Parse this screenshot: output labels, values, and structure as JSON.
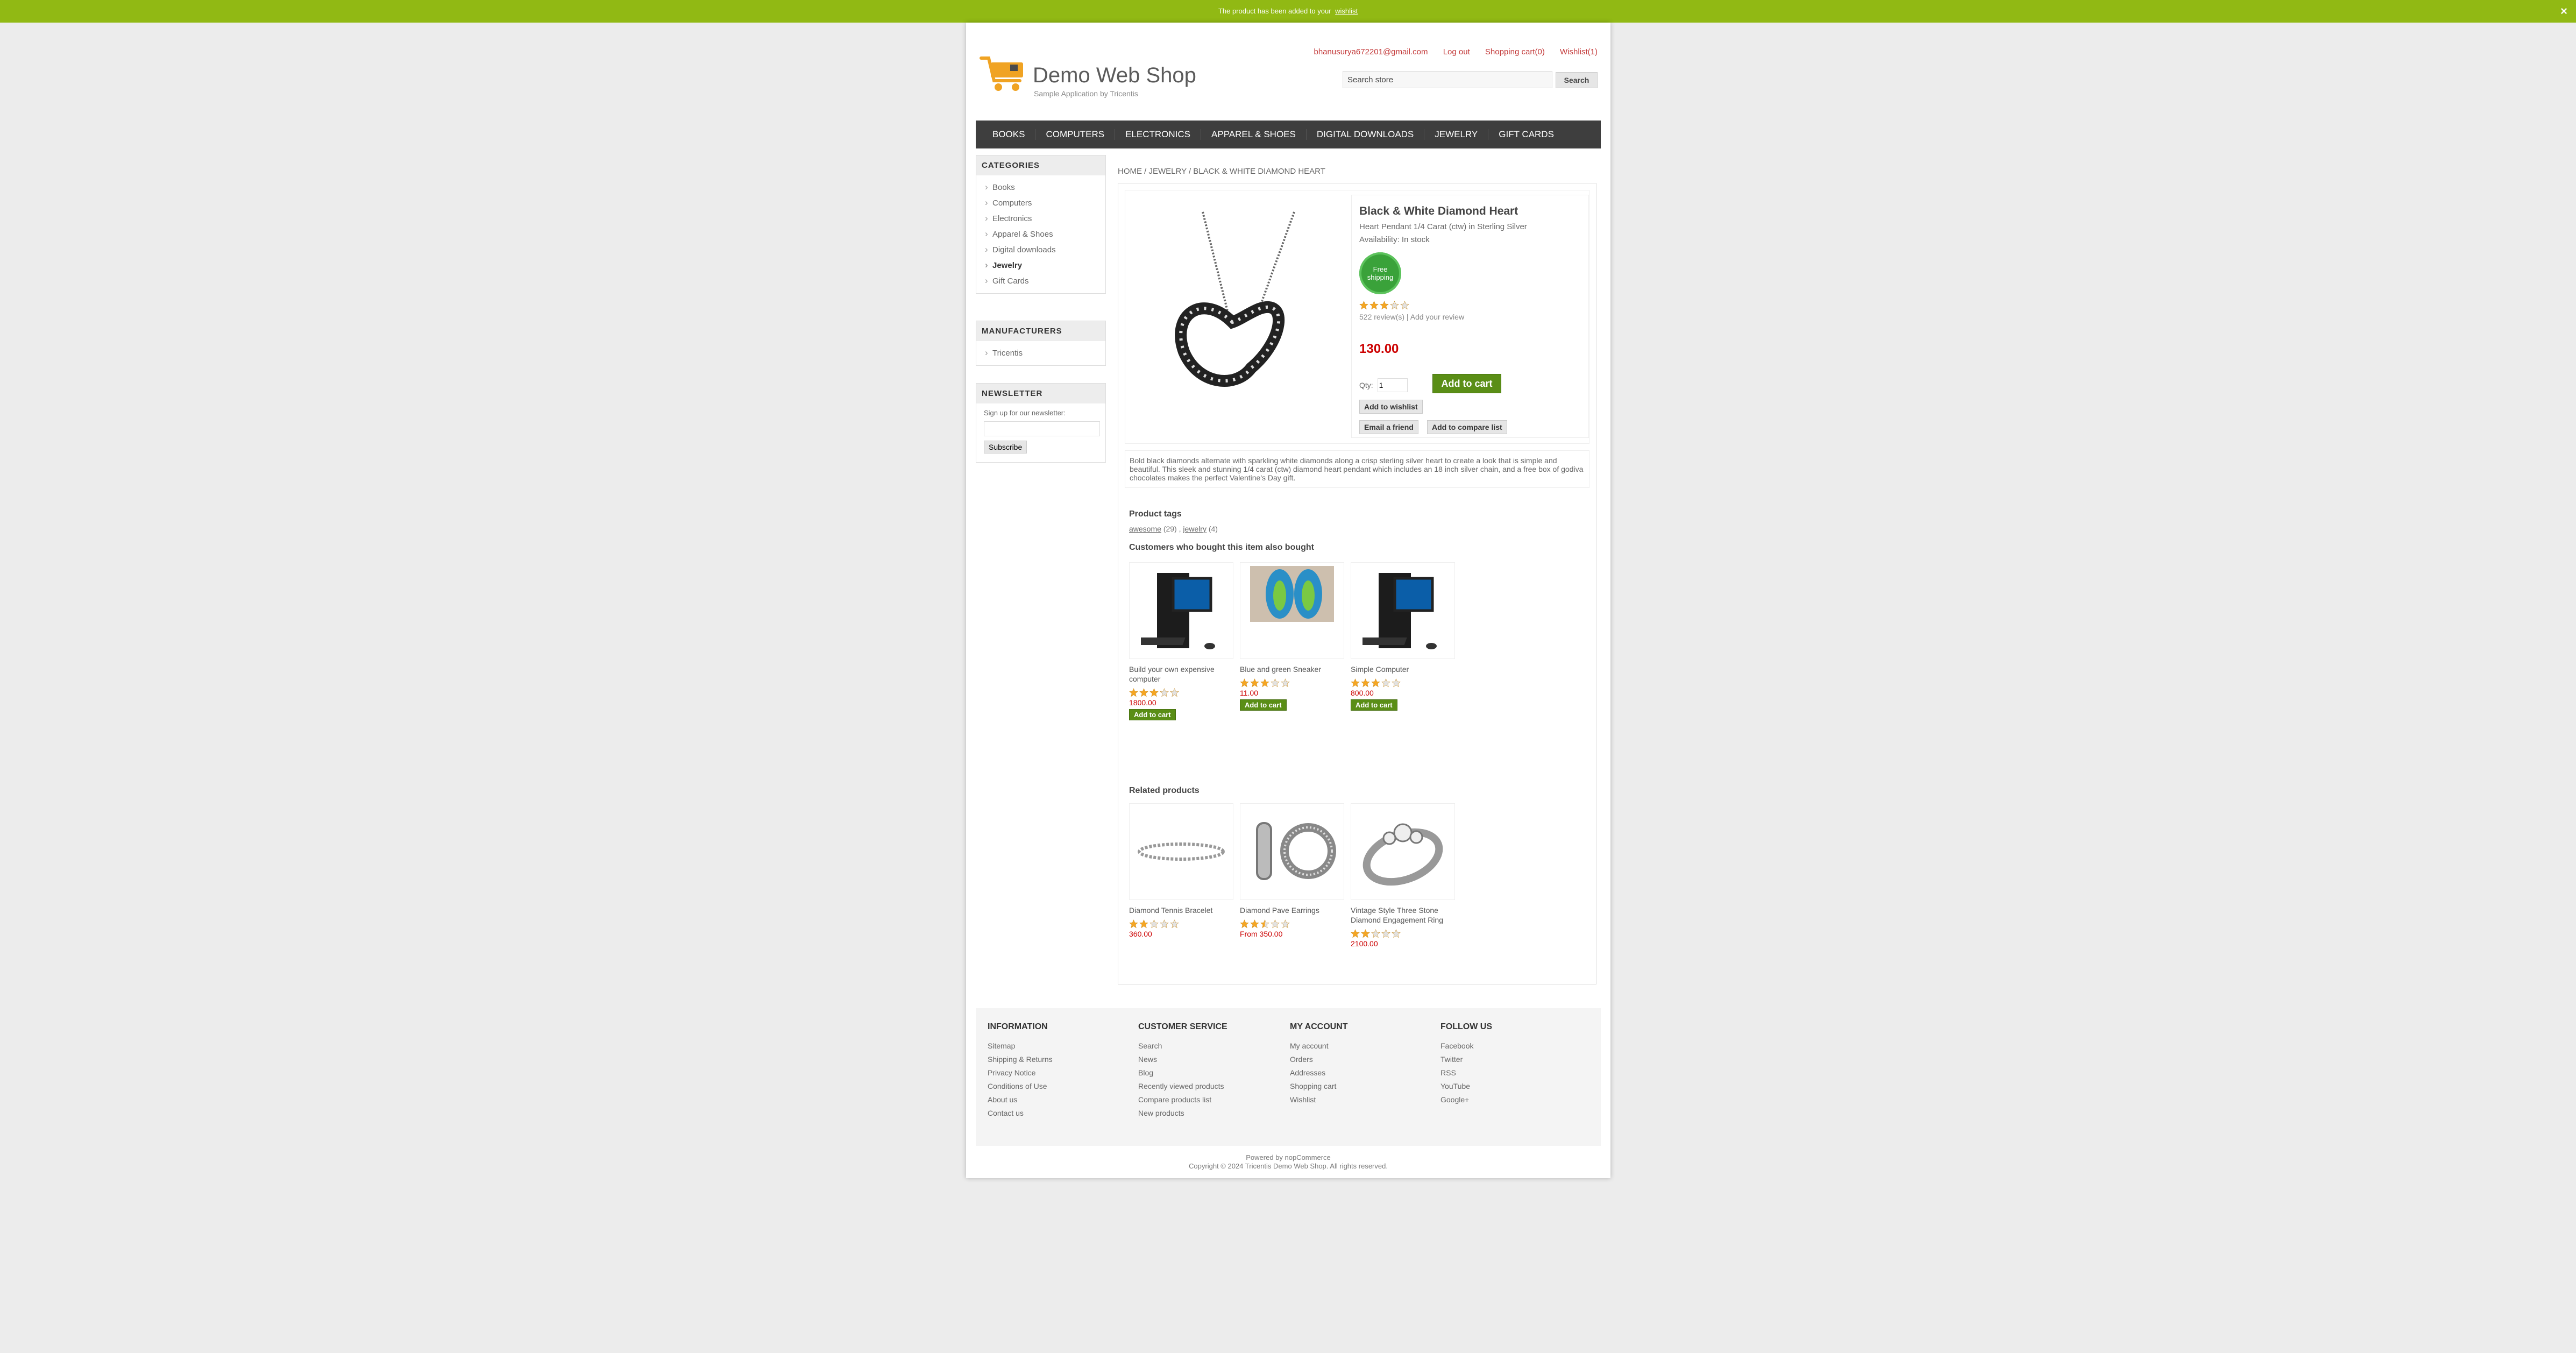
{
  "notification": {
    "text": "The product has been added to your",
    "link": "wishlist",
    "close": "×"
  },
  "header": {
    "logo_title": "Demo Web Shop",
    "logo_subtitle": "Sample Application by Tricentis",
    "links": {
      "email": "bhanusurya672201@gmail.com",
      "logout": "Log out",
      "cart": "Shopping cart(0)",
      "wishlist": "Wishlist(1)"
    },
    "search": {
      "value": "Search store",
      "button": "Search"
    }
  },
  "menu": [
    "BOOKS",
    "COMPUTERS",
    "ELECTRONICS",
    "APPAREL & SHOES",
    "DIGITAL DOWNLOADS",
    "JEWELRY",
    "GIFT CARDS"
  ],
  "sidebar": {
    "categories_title": "CATEGORIES",
    "categories": [
      "Books",
      "Computers",
      "Electronics",
      "Apparel & Shoes",
      "Digital downloads",
      "Jewelry",
      "Gift Cards"
    ],
    "manufacturers_title": "MANUFACTURERS",
    "manufacturers": [
      "Tricentis"
    ],
    "newsletter_title": "NEWSLETTER",
    "newsletter_label": "Sign up for our newsletter:",
    "newsletter_button": "Subscribe"
  },
  "breadcrumb": "HOME / JEWELRY / BLACK & WHITE DIAMOND HEART",
  "product": {
    "name": "Black & White Diamond Heart",
    "short": "Heart Pendant 1/4 Carat (ctw) in Sterling Silver",
    "availability": "Availability: In stock",
    "free_shipping": "Free shipping",
    "rating": 3,
    "reviews": "522 review(s)",
    "add_review": "Add your review",
    "price": "130.00",
    "qty_label": "Qty:",
    "qty_value": "1",
    "add_to_cart": "Add to cart",
    "add_to_wishlist": "Add to wishlist",
    "email_friend": "Email a friend",
    "compare": "Add to compare list",
    "description": "Bold black diamonds alternate with sparkling white diamonds along a crisp sterling silver heart to create a look that is simple and beautiful. This sleek and stunning 1/4 carat (ctw) diamond heart pendant which includes an 18 inch silver chain, and a free box of godiva chocolates makes the perfect Valentine's Day gift."
  },
  "tags": {
    "title": "Product tags",
    "items": [
      {
        "name": "awesome",
        "count": "(29)"
      },
      {
        "name": "jewelry",
        "count": "(4)"
      }
    ]
  },
  "also_bought": {
    "title": "Customers who bought this item also bought",
    "items": [
      {
        "name": "Build your own expensive computer",
        "rating": 3,
        "price": "1800.00",
        "button": "Add to cart",
        "img": "computer"
      },
      {
        "name": "Blue and green Sneaker",
        "rating": 3,
        "price": "11.00",
        "button": "Add to cart",
        "img": "sneaker"
      },
      {
        "name": "Simple Computer",
        "rating": 3,
        "price": "800.00",
        "button": "Add to cart",
        "img": "computer"
      }
    ]
  },
  "related": {
    "title": "Related products",
    "items": [
      {
        "name": "Diamond Tennis Bracelet",
        "rating": 2,
        "price": "360.00",
        "img": "bracelet"
      },
      {
        "name": "Diamond Pave Earrings",
        "rating": 2.5,
        "price": "From 350.00",
        "img": "earrings"
      },
      {
        "name": "Vintage Style Three Stone Diamond Engagement Ring",
        "rating": 2,
        "price": "2100.00",
        "img": "ring"
      }
    ]
  },
  "footer": {
    "columns": [
      {
        "title": "INFORMATION",
        "links": [
          "Sitemap",
          "Shipping & Returns",
          "Privacy Notice",
          "Conditions of Use",
          "About us",
          "Contact us"
        ]
      },
      {
        "title": "CUSTOMER SERVICE",
        "links": [
          "Search",
          "News",
          "Blog",
          "Recently viewed products",
          "Compare products list",
          "New products"
        ]
      },
      {
        "title": "MY ACCOUNT",
        "links": [
          "My account",
          "Orders",
          "Addresses",
          "Shopping cart",
          "Wishlist"
        ]
      },
      {
        "title": "FOLLOW US",
        "links": [
          "Facebook",
          "Twitter",
          "RSS",
          "YouTube",
          "Google+"
        ]
      }
    ],
    "powered": "Powered by nopCommerce",
    "copyright": "Copyright © 2024 Tricentis Demo Web Shop. All rights reserved."
  },
  "colors": {
    "accent_green": "#91b914",
    "price_red": "#cc0000",
    "menu_bg": "#3e3e3e",
    "star": "#f5a623"
  }
}
